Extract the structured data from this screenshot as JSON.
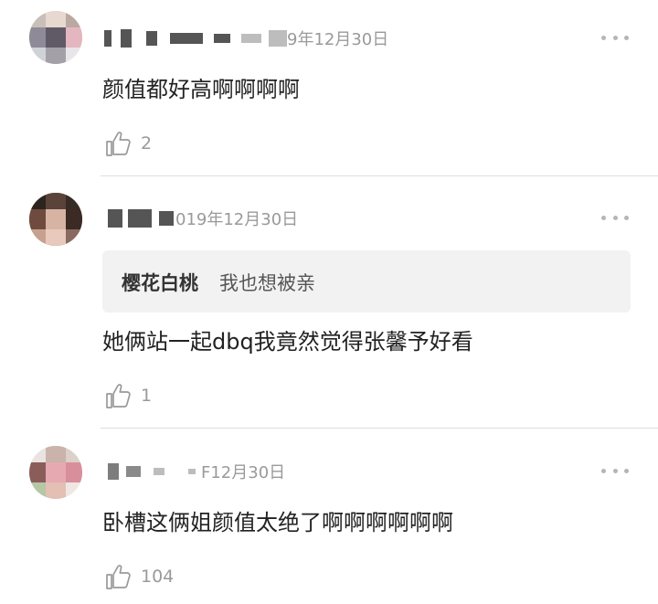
{
  "comments": [
    {
      "date": "9年12月30日",
      "text": "颜值都好高啊啊啊啊",
      "likes": "2",
      "more_icon": "more-dots-icon",
      "like_icon": "thumbs-up-icon"
    },
    {
      "date": "019年12月30日",
      "reply_to": {
        "name": "樱花白桃",
        "text": "我也想被亲"
      },
      "text": "她俩站一起dbq我竟然觉得张馨予好看",
      "likes": "1",
      "more_icon": "more-dots-icon",
      "like_icon": "thumbs-up-icon"
    },
    {
      "date": "F12月30日",
      "text": "卧槽这俩姐颜值太绝了啊啊啊啊啊啊",
      "likes": "104",
      "more_icon": "more-dots-icon",
      "like_icon": "thumbs-up-icon"
    }
  ],
  "colors": {
    "text": "#222222",
    "meta": "#9a9a9a",
    "divider": "#dedede",
    "quote_bg": "#f2f2f2"
  }
}
